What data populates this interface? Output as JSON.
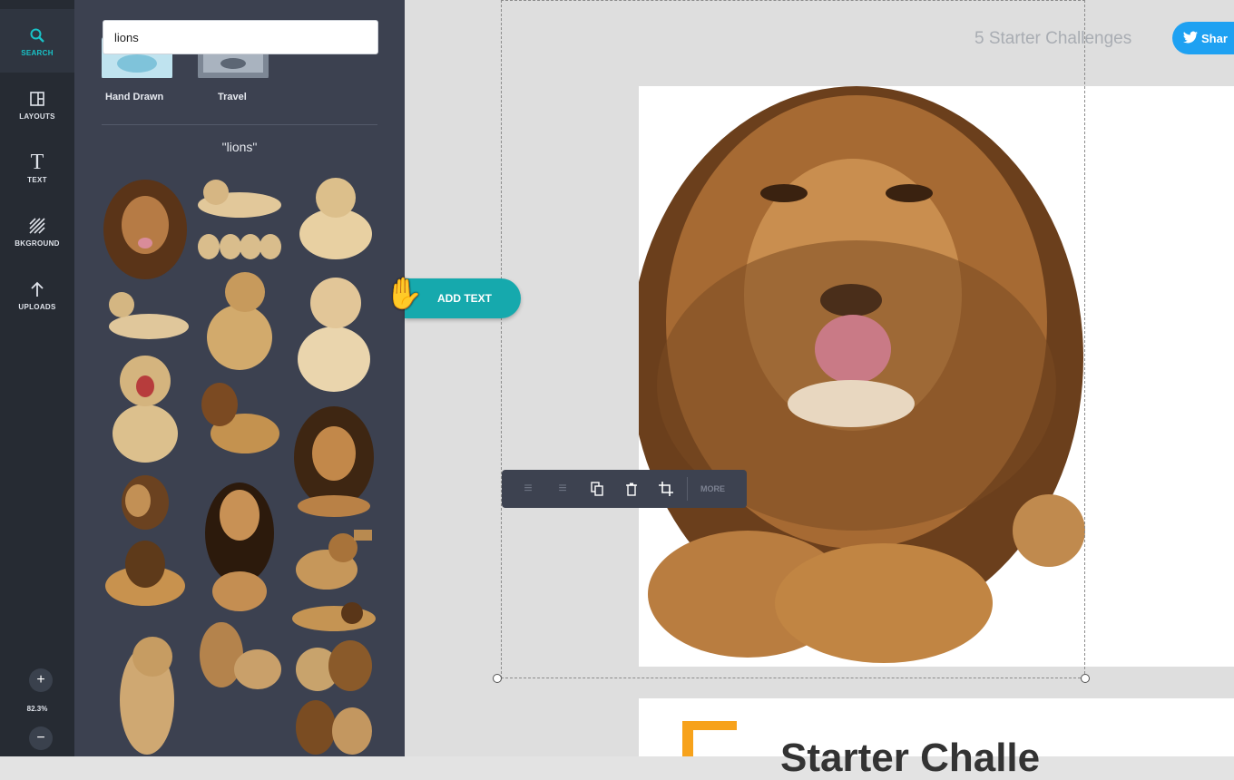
{
  "rail": {
    "items": [
      {
        "label": "SEARCH",
        "icon": "search-icon"
      },
      {
        "label": "LAYOUTS",
        "icon": "layouts-icon"
      },
      {
        "label": "TEXT",
        "icon": "text-icon"
      },
      {
        "label": "BKGROUND",
        "icon": "background-icon"
      },
      {
        "label": "UPLOADS",
        "icon": "upload-icon"
      }
    ],
    "zoom_in": "+",
    "zoom_level": "82.3%",
    "zoom_out": "−"
  },
  "panel": {
    "search_value": "lions",
    "categories": [
      {
        "label": "Hand Drawn"
      },
      {
        "label": "Travel"
      }
    ],
    "results_title": "\"lions\""
  },
  "canvas": {
    "page_title": "5 Starter Challenges",
    "share_label": "Shar",
    "add_text_label": "ADD TEXT",
    "toolbar_more": "MORE",
    "heading_fragment": "Starter Challe"
  },
  "colors": {
    "accent": "#19c3c8",
    "share": "#1ea1f2",
    "orange": "#f7a21b"
  }
}
